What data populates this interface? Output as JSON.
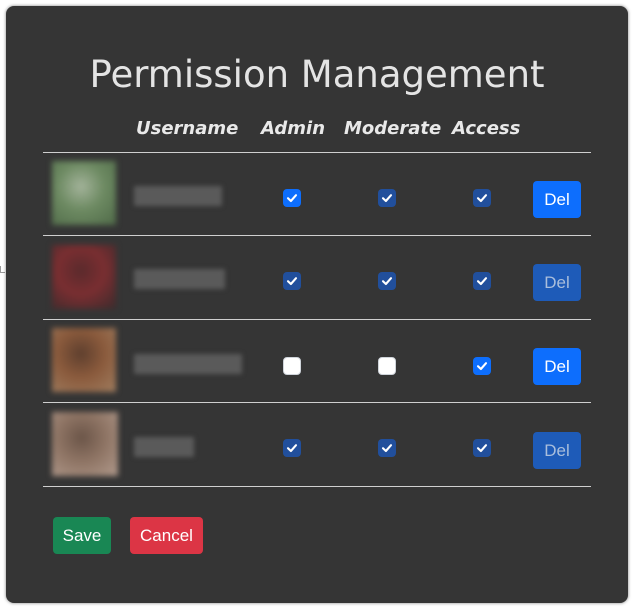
{
  "dialog": {
    "title": "Permission Management"
  },
  "table": {
    "columns": {
      "username": "Username",
      "admin": "Admin",
      "moderate": "Moderate",
      "access": "Access"
    },
    "rows": [
      {
        "avatar_colors": [
          "#6d8a62",
          "#a3b39a",
          "#4f6a48"
        ],
        "admin": {
          "checked": true,
          "disabled": false
        },
        "moderate": {
          "checked": true,
          "disabled": true
        },
        "access": {
          "checked": true,
          "disabled": true
        },
        "delete_label": "Del",
        "delete_enabled": true
      },
      {
        "avatar_colors": [
          "#7a2e31",
          "#5a2a2c",
          "#3b2b2c"
        ],
        "admin": {
          "checked": true,
          "disabled": true
        },
        "moderate": {
          "checked": true,
          "disabled": true
        },
        "access": {
          "checked": true,
          "disabled": true
        },
        "delete_label": "Del",
        "delete_enabled": false
      },
      {
        "avatar_colors": [
          "#8a5a3c",
          "#5e3f2e",
          "#a07d5f"
        ],
        "admin": {
          "checked": false,
          "disabled": false
        },
        "moderate": {
          "checked": false,
          "disabled": false
        },
        "access": {
          "checked": true,
          "disabled": false
        },
        "delete_label": "Del",
        "delete_enabled": true
      },
      {
        "avatar_colors": [
          "#8e7464",
          "#6b5548",
          "#b19a8c"
        ],
        "admin": {
          "checked": true,
          "disabled": true
        },
        "moderate": {
          "checked": true,
          "disabled": true
        },
        "access": {
          "checked": true,
          "disabled": true
        },
        "delete_label": "Del",
        "delete_enabled": false
      }
    ]
  },
  "footer": {
    "save_label": "Save",
    "cancel_label": "Cancel"
  },
  "colors": {
    "dialog_background": "#353535",
    "primary": "#0d6efd",
    "primary_disabled": "#214f9c",
    "success": "#198754",
    "danger": "#dc3545"
  }
}
